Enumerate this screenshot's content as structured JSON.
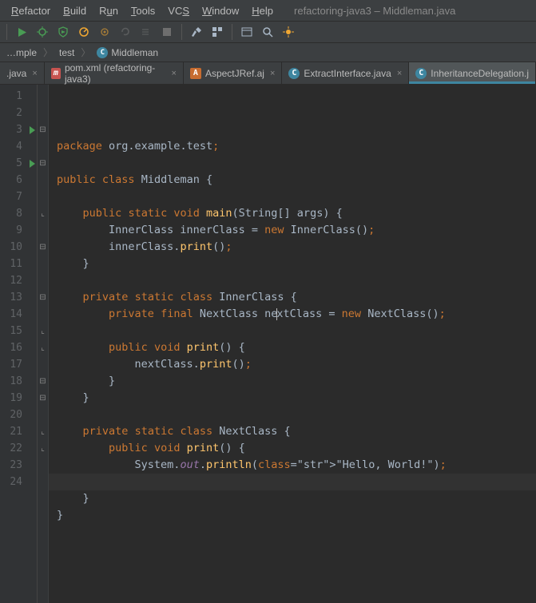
{
  "window_title": "refactoring-java3 – Middleman.java",
  "menu": {
    "refactor": "Refactor",
    "build": "Build",
    "run": "Run",
    "tools": "Tools",
    "vcs": "VCS",
    "window": "Window",
    "help": "Help"
  },
  "breadcrumb": {
    "b0": "…mple",
    "b1": "test",
    "b2": "Middleman"
  },
  "tabs": {
    "t0": ".java",
    "t1": "pom.xml (refactoring-java3)",
    "t2": "AspectJRef.aj",
    "t3": "ExtractInterface.java",
    "t4": "InheritanceDelegation.j"
  },
  "code": {
    "lines": [
      "package org.example.test;",
      "",
      "public class Middleman {",
      "",
      "    public static void main(String[] args) {",
      "        InnerClass innerClass = new InnerClass();",
      "        innerClass.print();",
      "    }",
      "",
      "    private static class InnerClass {",
      "        private final NextClass nextClass = new NextClass();",
      "",
      "        public void print() {",
      "            nextClass.print();",
      "        }",
      "    }",
      "",
      "    private static class NextClass {",
      "        public void print() {",
      "            System.out.println(\"Hello, World!\");",
      "        }",
      "    }",
      "}",
      ""
    ],
    "last_line": 24
  }
}
